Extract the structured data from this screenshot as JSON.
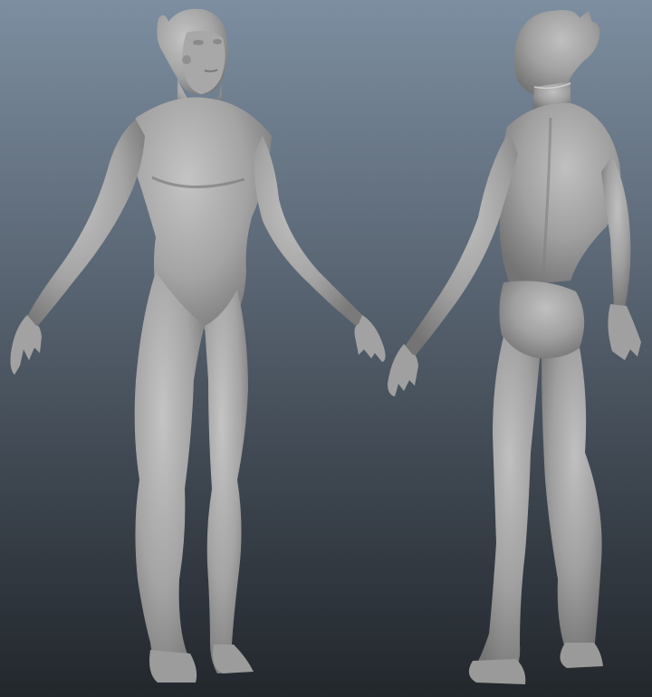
{
  "viewport": {
    "background_top": "#7c8ea0",
    "background_bottom": "#22272c",
    "model_color": "#a4a4a4",
    "model_shadow": "#6e6e6e",
    "model_highlight": "#c4c4c4"
  },
  "models": [
    {
      "name": "alien-figure-front-view"
    },
    {
      "name": "alien-figure-back-view"
    }
  ]
}
